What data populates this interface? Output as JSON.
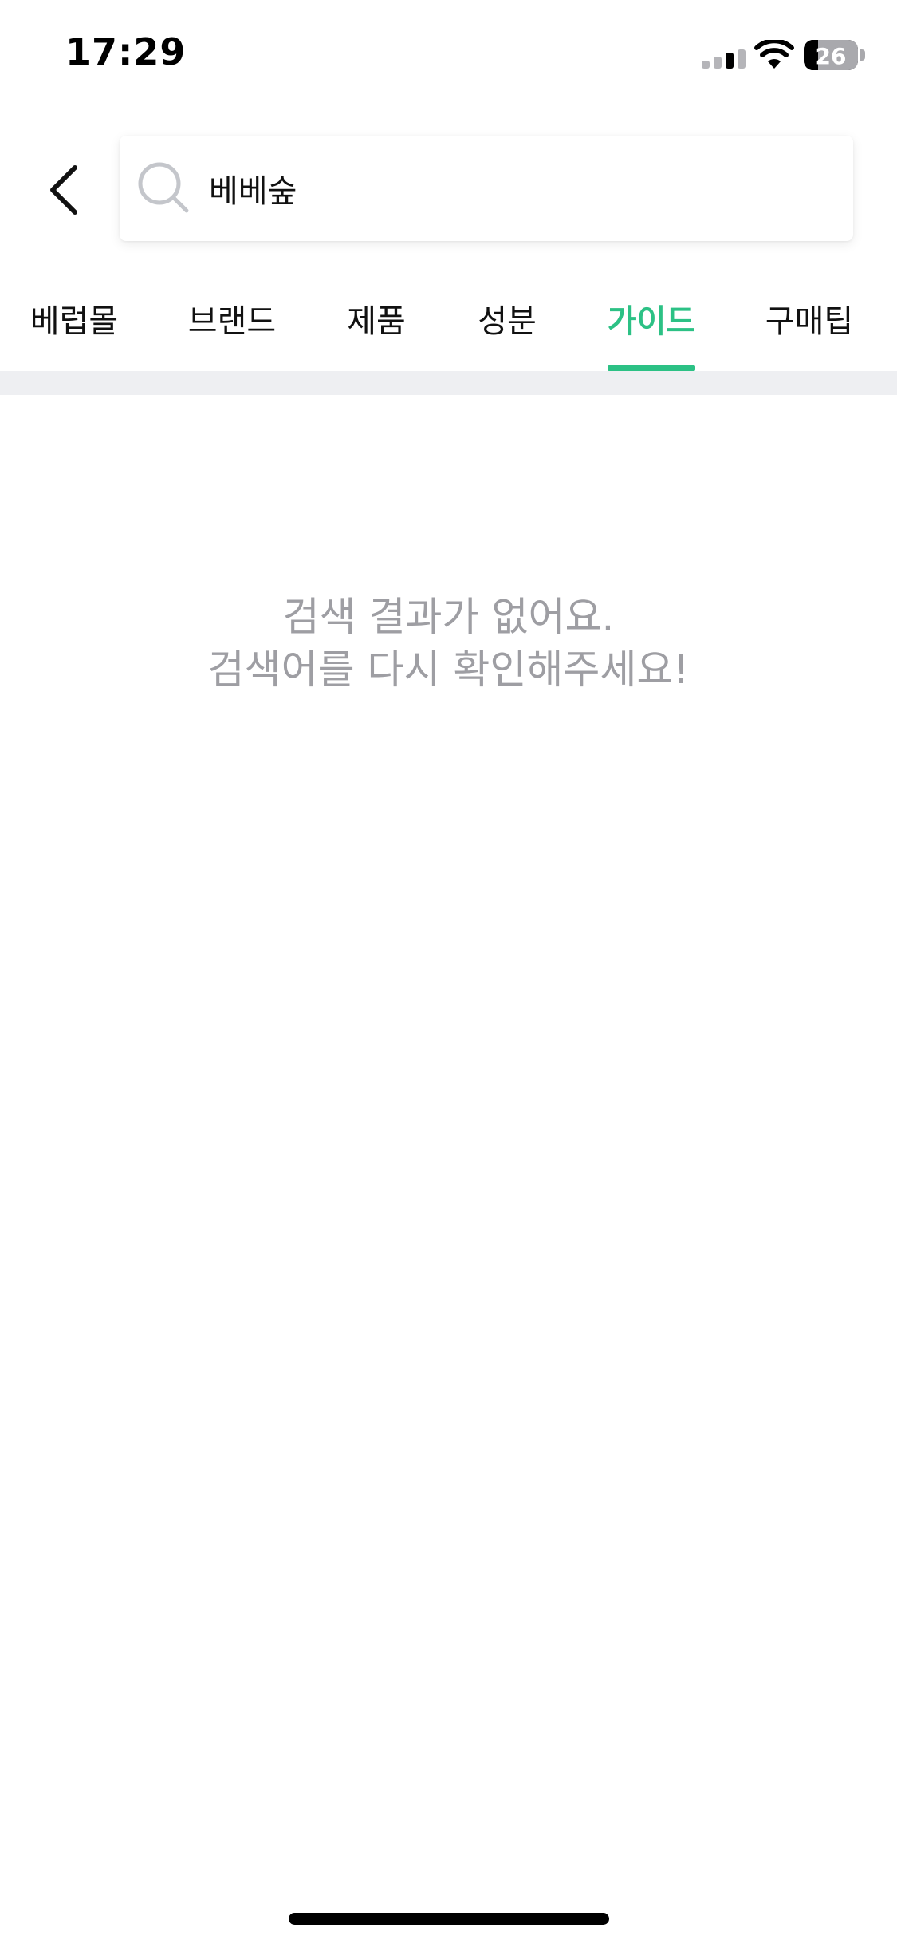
{
  "status_bar": {
    "time": "17:29",
    "battery_percent": "26",
    "battery_level": 0.26,
    "icons": [
      "cellular-signal-icon",
      "wifi-icon",
      "battery-icon"
    ]
  },
  "header": {
    "back_icon": "chevron-left-icon",
    "search": {
      "icon": "search-icon",
      "value": "베베숲"
    }
  },
  "tabs": [
    {
      "label": "베럽몰",
      "active": false
    },
    {
      "label": "브랜드",
      "active": false
    },
    {
      "label": "제품",
      "active": false
    },
    {
      "label": "성분",
      "active": false
    },
    {
      "label": "가이드",
      "active": true
    },
    {
      "label": "구매팁",
      "active": false
    }
  ],
  "empty_state": {
    "line1": "검색 결과가 없어요.",
    "line2": "검색어를 다시 확인해주세요!"
  },
  "colors": {
    "accent": "#2cc185",
    "empty_text": "#9e9ea3",
    "divider": "#eeeff2"
  }
}
